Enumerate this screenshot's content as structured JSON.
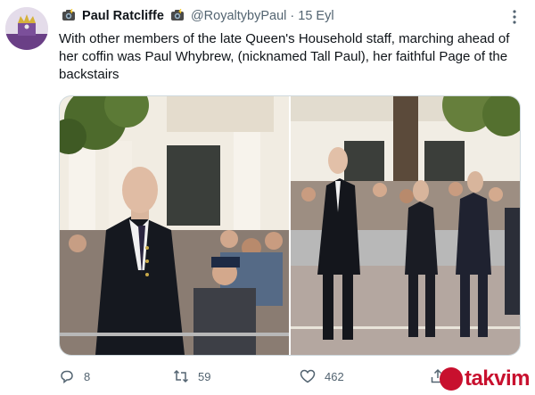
{
  "tweet": {
    "author_name": "Paul Ratcliffe",
    "handle": "@RoyaltybyPaul",
    "separator": "·",
    "date": "15 Eyl",
    "text": "With other members of the late Queen's Household staff, marching ahead of her coffin was Paul Whybrew, (nicknamed Tall Paul), her faithful Page of the backstairs"
  },
  "actions": {
    "replies": "8",
    "retweets": "59",
    "likes": "462"
  },
  "watermark": {
    "text": "takvim",
    "color": "#c8102e"
  },
  "icons": {
    "avatar": "avatar-crown",
    "camera_emoji": "camera-with-flash-emoji",
    "more": "more-dots-icon",
    "reply": "reply-icon",
    "retweet": "retweet-icon",
    "like": "heart-icon",
    "share": "share-icon"
  },
  "colors": {
    "text": "#0f1419",
    "secondary": "#536471",
    "border": "#cfd9de"
  }
}
